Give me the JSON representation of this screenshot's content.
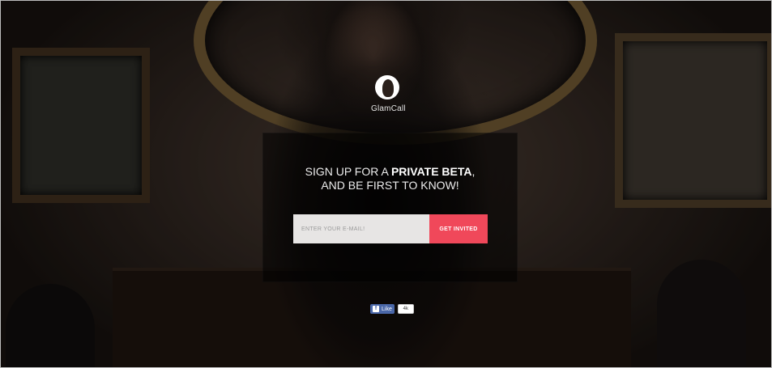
{
  "brand": {
    "name": "GlamCall"
  },
  "signup": {
    "headline_prefix": "SIGN UP FOR A ",
    "headline_bold": "PRIVATE BETA",
    "headline_suffix": ",",
    "headline_line2": "AND BE FIRST TO KNOW!",
    "email_placeholder": "ENTER YOUR E-MAIL!",
    "button_label": "GET INVITED"
  },
  "social": {
    "like_label": "Like",
    "like_icon": "facebook-icon",
    "like_count": "4k"
  },
  "colors": {
    "accent": "#f0485a",
    "facebook": "#4a67a8"
  }
}
